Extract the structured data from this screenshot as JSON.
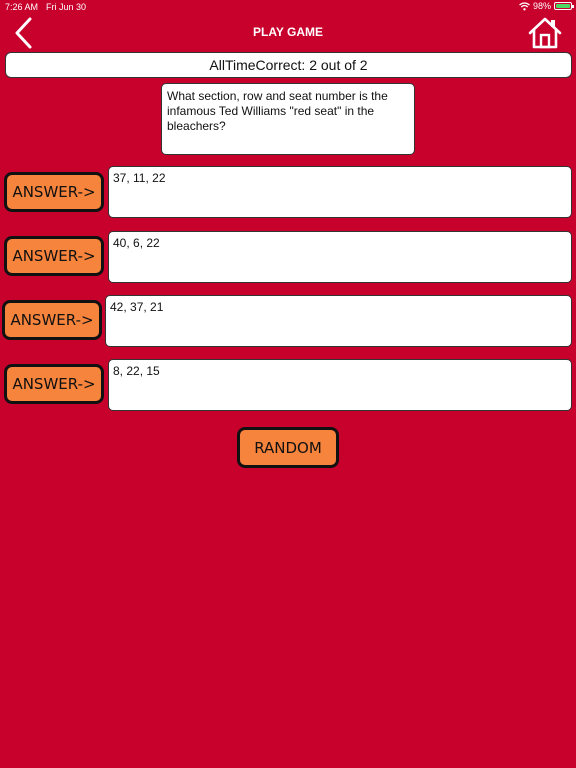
{
  "status_bar": {
    "time": "7:26 AM",
    "date": "Fri Jun 30",
    "battery": "98%",
    "icons": [
      "wifi-icon",
      "battery-icon"
    ]
  },
  "header": {
    "title": "PLAY GAME",
    "back_icon": "chevron-left-icon",
    "home_icon": "home-icon"
  },
  "score": {
    "text": "AllTimeCorrect: 2 out of 2"
  },
  "question": {
    "text": "What section, row and seat number is the infamous Ted Williams \"red seat\" in the bleachers?"
  },
  "answers": [
    {
      "button_label": "ANSWER->",
      "value": "37, 11, 22"
    },
    {
      "button_label": "ANSWER->",
      "value": "40, 6, 22"
    },
    {
      "button_label": "ANSWER->",
      "value": "42, 37, 21"
    },
    {
      "button_label": "ANSWER->",
      "value": "8, 22, 15"
    }
  ],
  "random_button": {
    "label": "RANDOM"
  },
  "colors": {
    "background": "#c8002c",
    "button": "#f7843c",
    "battery_fill": "#4cd964",
    "text_light": "#ffffff"
  }
}
